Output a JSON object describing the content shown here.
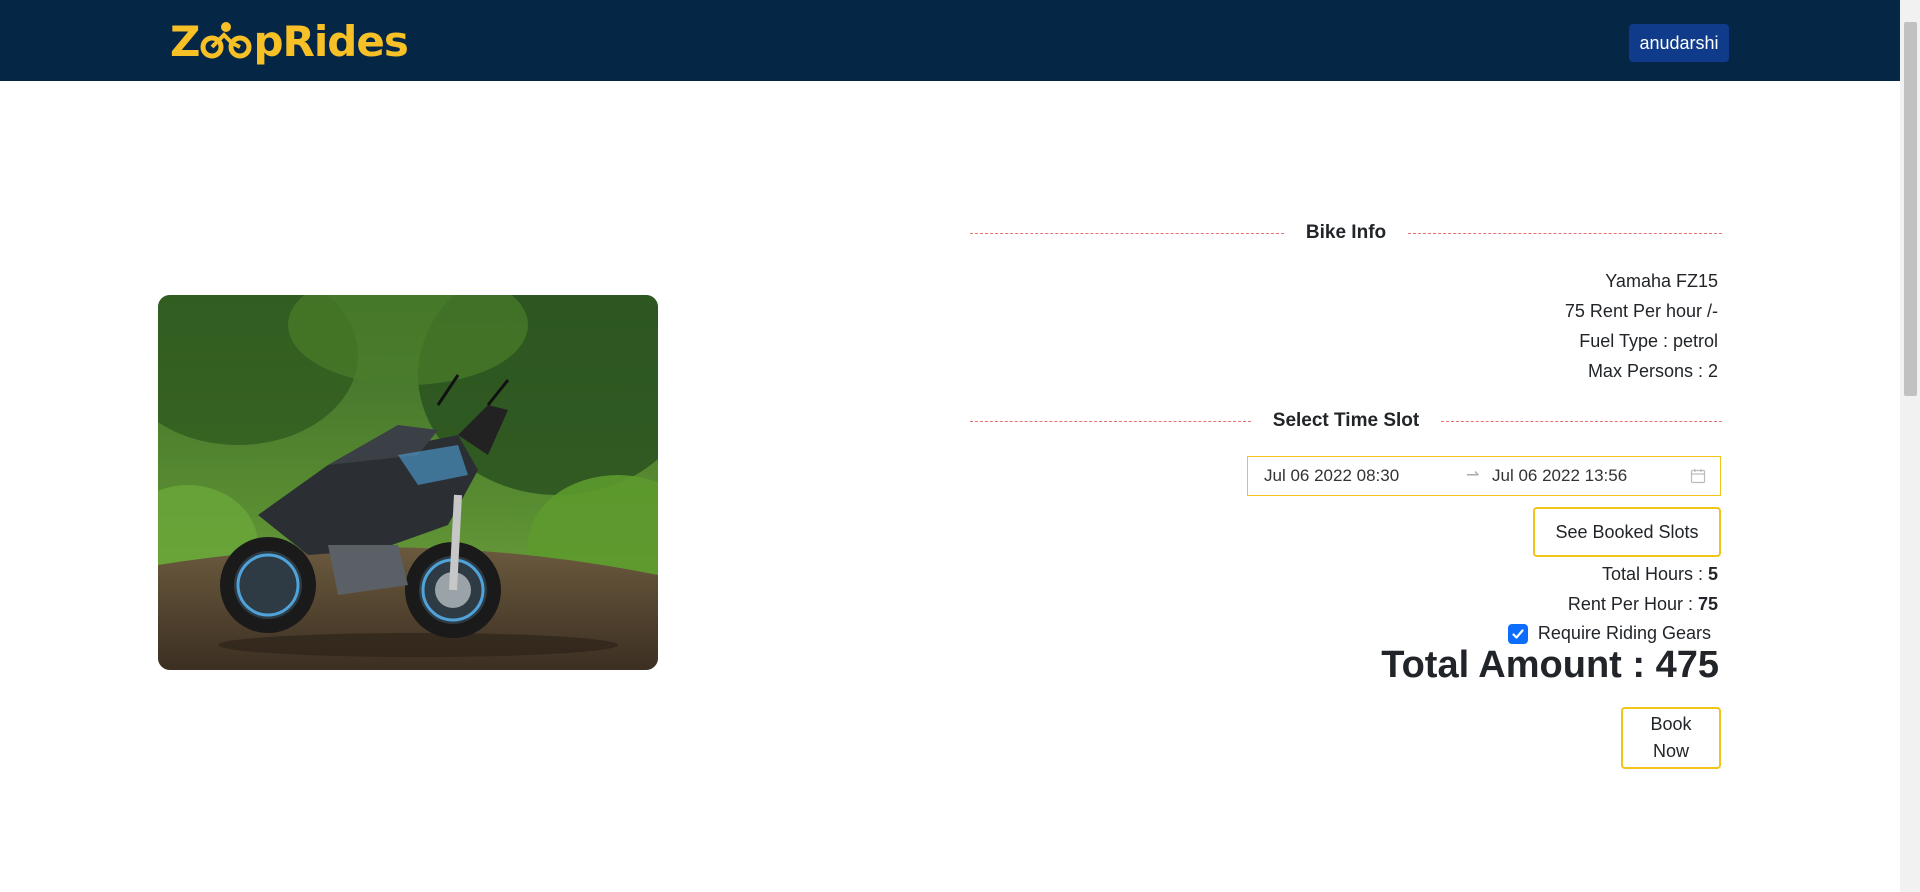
{
  "header": {
    "logo_text_start": "Z",
    "logo_text_end": "pRides",
    "user_label": "anudarshi"
  },
  "bike_info": {
    "section_title": "Bike Info",
    "model": "Yamaha FZ15",
    "rent_line": "75 Rent Per hour /-",
    "fuel_line": "Fuel Type : petrol",
    "persons_line": "Max Persons : 2"
  },
  "time_slot": {
    "section_title": "Select Time Slot",
    "start_date": "Jul 06 2022 08:30",
    "end_date": "Jul 06 2022 13:56",
    "see_booked_label": "See Booked Slots"
  },
  "summary": {
    "total_hours_label": "Total Hours : ",
    "total_hours_value": "5",
    "rent_per_hour_label": "Rent Per Hour : ",
    "rent_per_hour_value": "75",
    "riding_gears_label": "Require Riding Gears",
    "riding_gears_checked": true,
    "total_amount": "Total Amount : 475",
    "book_label": "Book Now"
  },
  "colors": {
    "navbar": "#052745",
    "logo": "#f6c026",
    "user_button": "#0f3b8a",
    "accent_border": "#f0c419",
    "divider": "#e57373",
    "checkbox": "#0d6efd"
  }
}
